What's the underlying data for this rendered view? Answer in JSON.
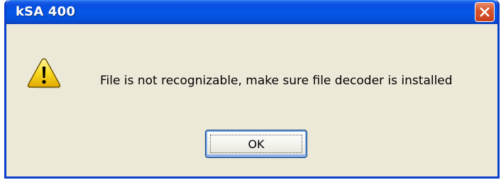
{
  "window": {
    "title": "kSA 400"
  },
  "dialog": {
    "icon": "warning-icon",
    "message": "File is not recognizable, make sure file decoder is installed",
    "ok_label": "OK"
  },
  "colors": {
    "titlebar": "#0556e6",
    "body_bg": "#ece9d8",
    "close_button": "#d8552c",
    "warning_yellow": "#f8d820"
  }
}
